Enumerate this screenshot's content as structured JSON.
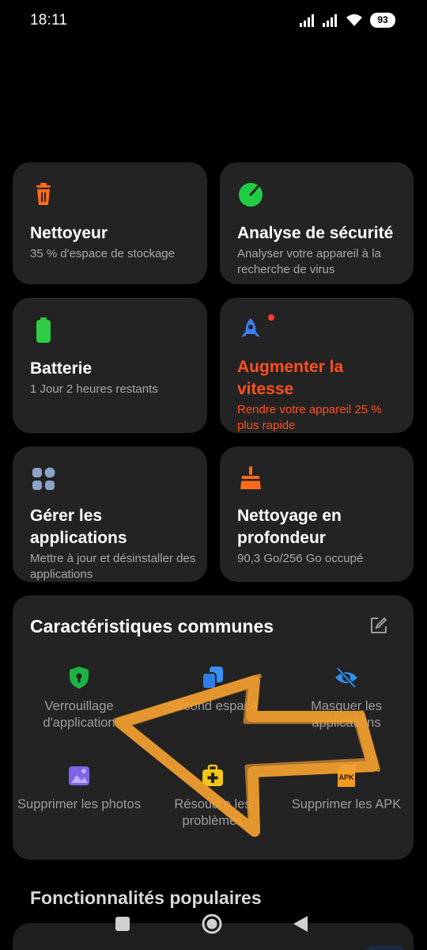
{
  "status_bar": {
    "time": "18:11",
    "battery": "93",
    "icons": [
      "signal-icon",
      "signal-icon",
      "wifi-icon",
      "battery-icon"
    ]
  },
  "cards": {
    "cleaner": {
      "title": "Nettoyeur",
      "subtitle": "35 % d'espace de stockage",
      "icon": "trash-icon",
      "icon_color": "#ff6a1a"
    },
    "security": {
      "title": "Analyse de sécurité",
      "subtitle": "Analyser votre appareil à la recherche de virus",
      "icon": "security-scan-icon",
      "icon_color": "#1fcc44"
    },
    "battery": {
      "title": "Batterie",
      "subtitle": "1 Jour 2 heures  restants",
      "icon": "battery-icon",
      "icon_color": "#2fcc45"
    },
    "boost": {
      "title": "Augmenter la vitesse",
      "subtitle": "Rendre votre appareil 25 % plus rapide",
      "icon": "rocket-icon",
      "icon_color": "#3d7df5",
      "accent": "#ff4f1f"
    },
    "apps": {
      "title": "Gérer les applications",
      "subtitle": "Mettre à jour et désinstaller des applications",
      "icon": "apps-grid-icon",
      "icon_color": "#8ba3c7"
    },
    "deep_clean": {
      "title": "Nettoyage en profondeur",
      "subtitle": "90,3 Go/256 Go occupé",
      "icon": "broom-icon",
      "icon_color": "#ff6a1a"
    }
  },
  "common_features": {
    "title": "Caractéristiques communes",
    "edit_icon": "edit-icon",
    "items": [
      {
        "label": "Verrouillage d'application",
        "icon": "shield-lock-icon"
      },
      {
        "label": "Second espace",
        "icon": "dual-space-icon"
      },
      {
        "label": "Masquer les applications",
        "icon": "eye-hidden-icon"
      },
      {
        "label": "Supprimer les photos",
        "icon": "photo-icon"
      },
      {
        "label": "Résoudre les problèmes",
        "icon": "first-aid-icon"
      },
      {
        "label": "Supprimer les APK",
        "icon": "apk-icon"
      }
    ]
  },
  "popular": {
    "title": "Fonctionnalités populaires"
  },
  "nav": {
    "buttons": [
      "recents-icon",
      "home-icon",
      "back-icon"
    ]
  },
  "colors": {
    "background": "#000000",
    "card": "#232323",
    "orange": "#ff6a1a",
    "annotation_arrow": "#f5a030"
  }
}
